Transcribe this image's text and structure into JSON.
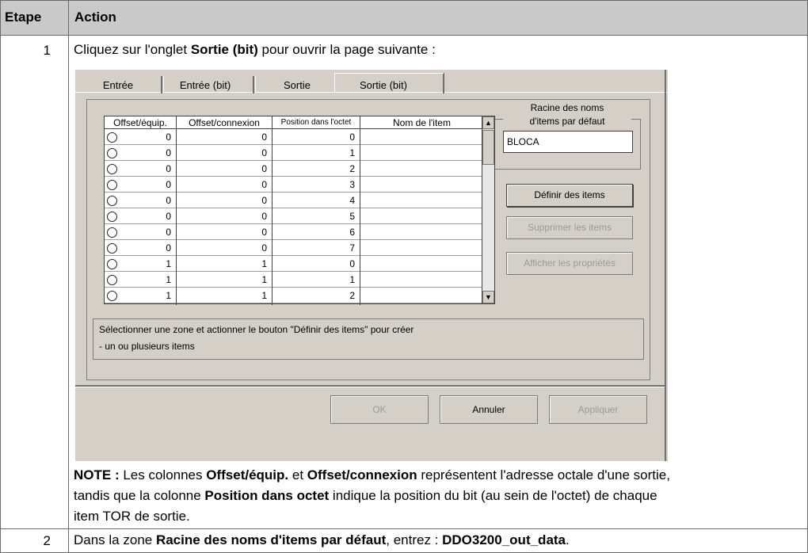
{
  "table": {
    "headers": {
      "step": "Etape",
      "action": "Action"
    },
    "rows": [
      {
        "step": "1",
        "intro": {
          "a": "Cliquez sur l'onglet ",
          "b": "Sortie (bit)",
          "c": " pour ouvrir la page suivante :"
        },
        "note": {
          "label": "NOTE :",
          "p1": " Les colonnes ",
          "b1": "Offset/équip.",
          "p2": " et ",
          "b2": "Offset/connexion",
          "p3": " représentent l'adresse octale d'une sortie,",
          "p4": "tandis que la colonne ",
          "b3": "Position dans octet",
          "p5": " indique la position du bit (au sein de l'octet) de chaque",
          "p6": "item TOR de sortie."
        }
      },
      {
        "step": "2",
        "text": {
          "a": "Dans la zone ",
          "b": "Racine des noms d'items par défaut",
          "c": ", entrez : ",
          "d": "DDO3200_out_data",
          "e": "."
        }
      }
    ]
  },
  "dialog": {
    "tabs": [
      "Entrée",
      "Entrée (bit)",
      "Sortie",
      "Sortie (bit)"
    ],
    "active_tab": "Sortie (bit)",
    "grid": {
      "columns": [
        "Offset/équip.",
        "Offset/connexion",
        "Position dans l'octet",
        "Nom de l'item"
      ],
      "rows": [
        [
          "0",
          "0",
          "0",
          ""
        ],
        [
          "0",
          "0",
          "1",
          ""
        ],
        [
          "0",
          "0",
          "2",
          ""
        ],
        [
          "0",
          "0",
          "3",
          ""
        ],
        [
          "0",
          "0",
          "4",
          ""
        ],
        [
          "0",
          "0",
          "5",
          ""
        ],
        [
          "0",
          "0",
          "6",
          ""
        ],
        [
          "0",
          "0",
          "7",
          ""
        ],
        [
          "1",
          "1",
          "0",
          ""
        ],
        [
          "1",
          "1",
          "1",
          ""
        ],
        [
          "1",
          "1",
          "2",
          ""
        ]
      ]
    },
    "root_group": {
      "title_line1": "Racine des noms",
      "title_line2": "d'items par défaut",
      "value": "BLOCA"
    },
    "buttons": {
      "define": "Définir des items",
      "delete": "Supprimer les items",
      "properties": "Afficher les propriétés",
      "ok": "OK",
      "cancel": "Annuler",
      "apply": "Appliquer"
    },
    "description": {
      "line1": "Sélectionner une zone et actionner le bouton \"Définir des items\" pour créer",
      "line2": "- un ou plusieurs items"
    }
  }
}
